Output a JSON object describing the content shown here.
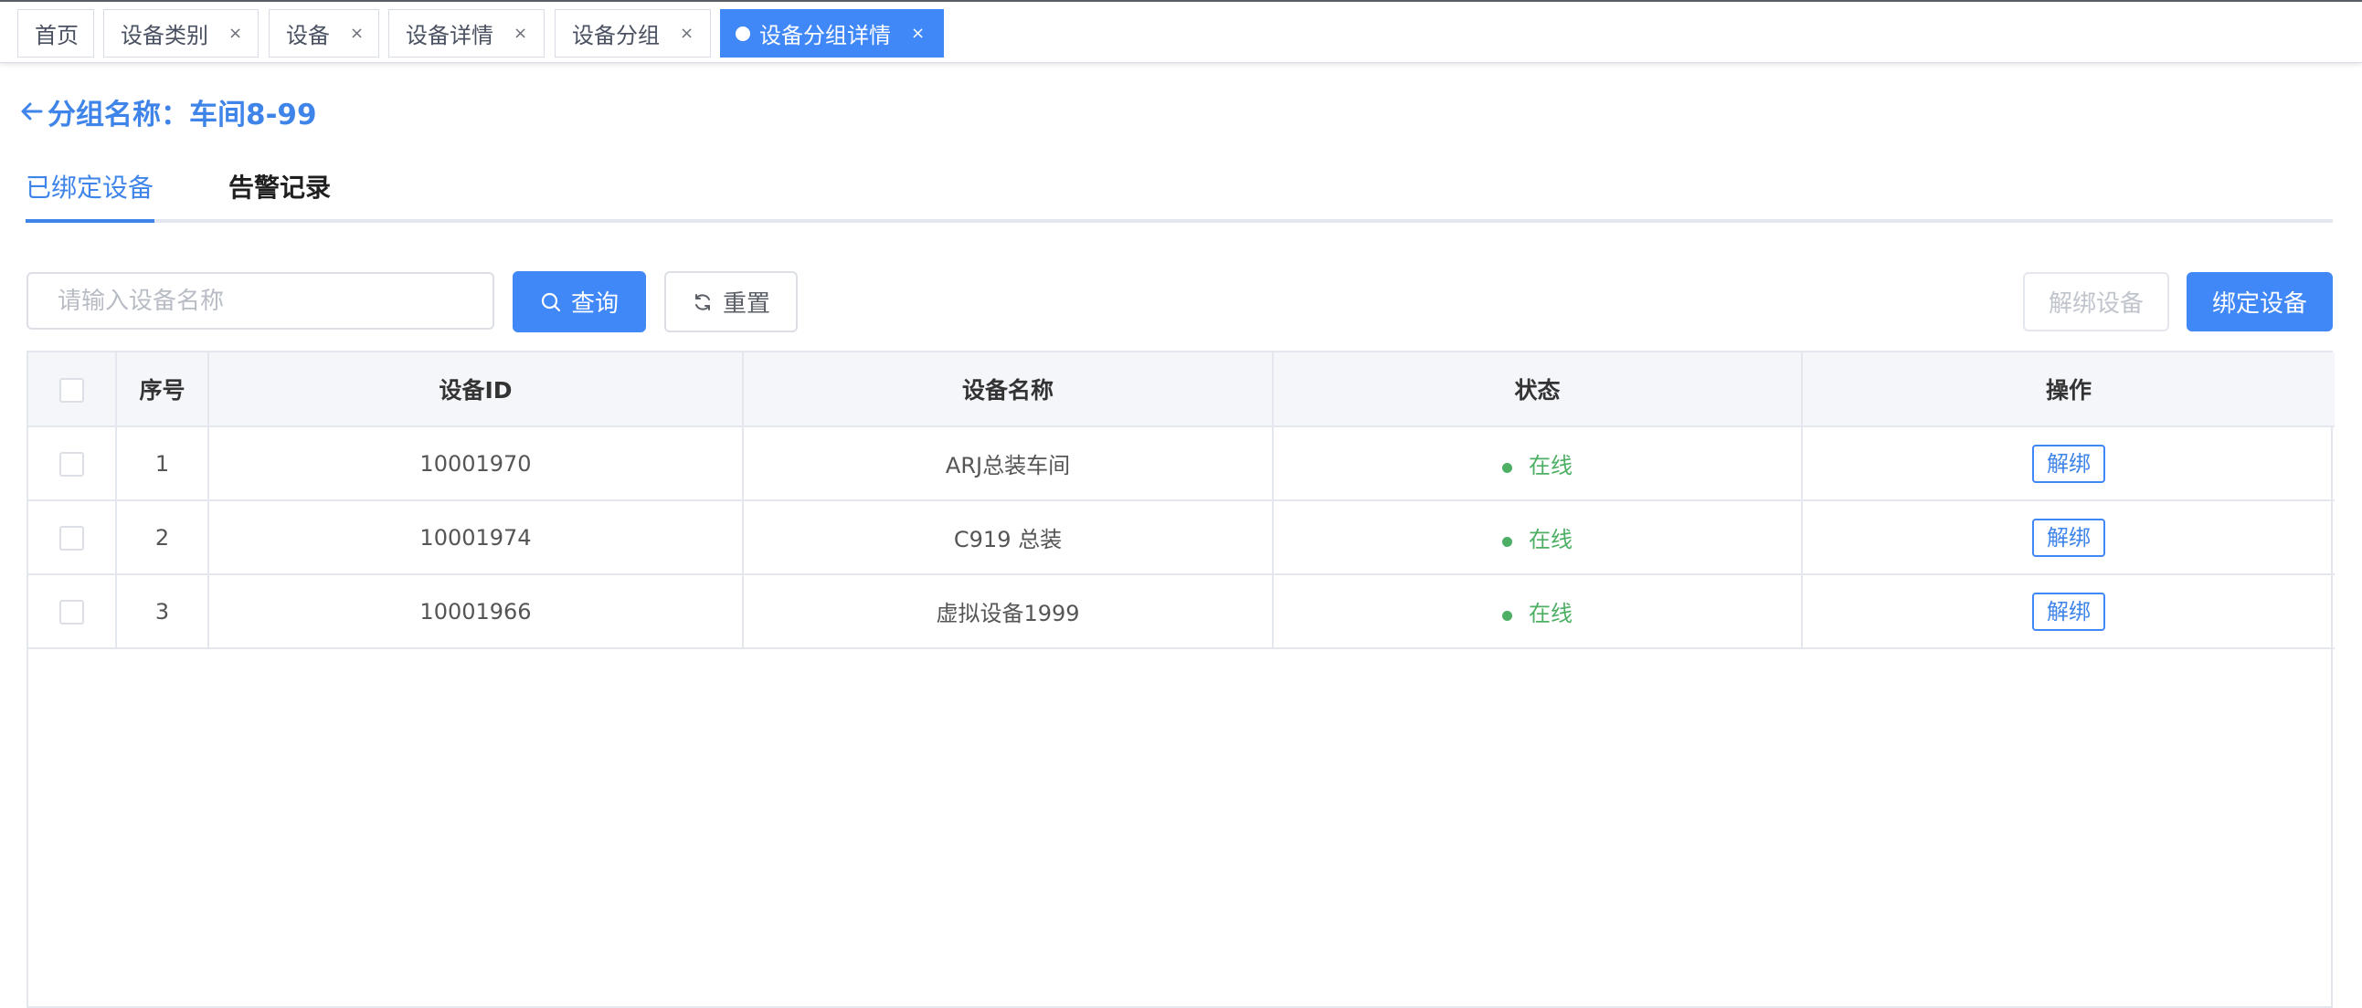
{
  "tags": [
    {
      "label": "首页",
      "closable": false,
      "active": false
    },
    {
      "label": "设备类别",
      "closable": true,
      "active": false
    },
    {
      "label": "设备",
      "closable": true,
      "active": false
    },
    {
      "label": "设备详情",
      "closable": true,
      "active": false
    },
    {
      "label": "设备分组",
      "closable": true,
      "active": false
    },
    {
      "label": "设备分组详情",
      "closable": true,
      "active": true
    }
  ],
  "close_glyph": "×",
  "header": {
    "title": "分组名称：车间8-99",
    "back_icon": "arrow-left-icon"
  },
  "tabs": [
    {
      "label": "已绑定设备",
      "active": true
    },
    {
      "label": "告警记录",
      "active": false
    }
  ],
  "toolbar": {
    "search_placeholder": "请输入设备名称",
    "search_value": "",
    "query_label": "查询",
    "reset_label": "重置",
    "unbind_device_label": "解绑设备",
    "bind_device_label": "绑定设备"
  },
  "table": {
    "columns": [
      "",
      "序号",
      "设备ID",
      "设备名称",
      "状态",
      "操作"
    ],
    "rows": [
      {
        "index": "1",
        "device_id": "10001970",
        "device_name": "ARJ总装车间",
        "status": "在线",
        "action": "解绑"
      },
      {
        "index": "2",
        "device_id": "10001974",
        "device_name": "C919 总装",
        "status": "在线",
        "action": "解绑"
      },
      {
        "index": "3",
        "device_id": "10001966",
        "device_name": "虚拟设备1999",
        "status": "在线",
        "action": "解绑"
      }
    ]
  },
  "colors": {
    "primary": "#4088f7",
    "title_blue": "#3f84e9",
    "status_online": "#4caf63"
  }
}
